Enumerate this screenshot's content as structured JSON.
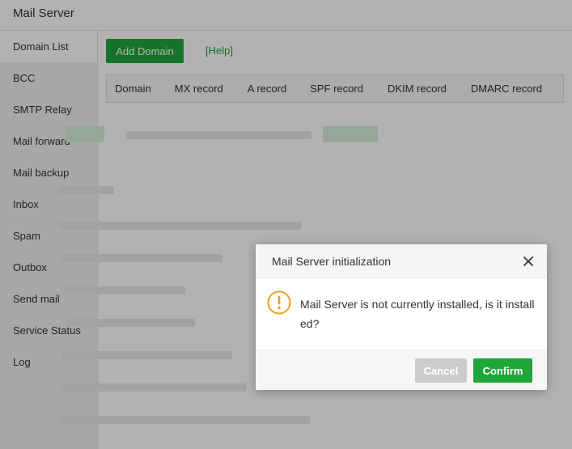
{
  "window": {
    "title": "Mail Server"
  },
  "sidebar": {
    "items": [
      {
        "label": "Domain List"
      },
      {
        "label": "BCC"
      },
      {
        "label": "SMTP Relay"
      },
      {
        "label": "Mail forward"
      },
      {
        "label": "Mail backup"
      },
      {
        "label": "Inbox"
      },
      {
        "label": "Spam"
      },
      {
        "label": "Outbox"
      },
      {
        "label": "Send mail"
      },
      {
        "label": "Service Status"
      },
      {
        "label": "Log"
      }
    ]
  },
  "toolbar": {
    "add_domain_label": "Add Domain",
    "help_label": "[Help]"
  },
  "table": {
    "columns": [
      "Domain",
      "MX record",
      "A record",
      "SPF record",
      "DKIM record",
      "DMARC record"
    ]
  },
  "dialog": {
    "title": "Mail Server initialization",
    "message": "Mail Server is not currently installed, is it installed?",
    "cancel_label": "Cancel",
    "confirm_label": "Confirm"
  },
  "colors": {
    "accent": "#20a53a",
    "warning": "#f0a020",
    "overlay": "rgba(0,0,0,0.3)"
  }
}
